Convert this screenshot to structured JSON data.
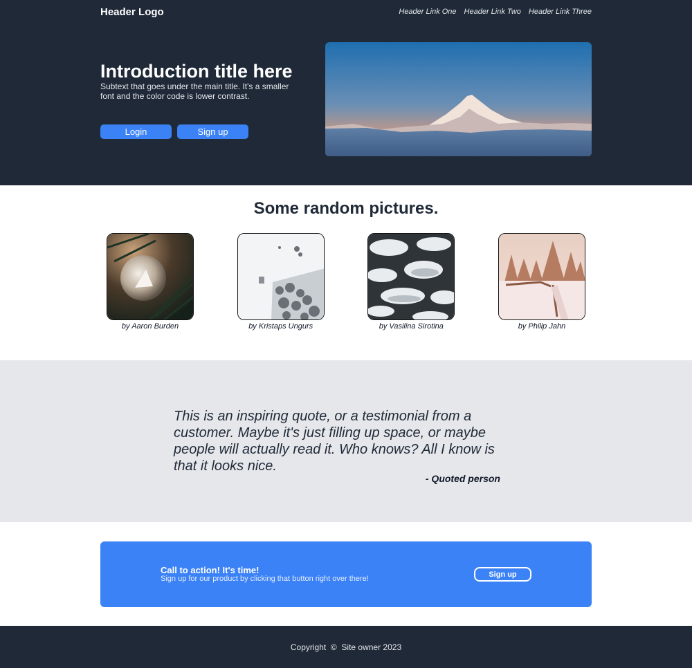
{
  "header": {
    "logo": "Header Logo",
    "links": [
      "Header Link One",
      "Header Link Two",
      "Header Link Three"
    ]
  },
  "hero": {
    "title": "Introduction title here",
    "subtitle": "Subtext that goes under the main title. It's a smaller font and the color code is lower contrast.",
    "login_label": "Login",
    "signup_label": "Sign up",
    "image_icon": "mountain-image"
  },
  "pictures": {
    "title": "Some random pictures.",
    "items": [
      {
        "caption": "by Aaron Burden",
        "icon": "ornament-photo"
      },
      {
        "caption": "by Kristaps Ungurs",
        "icon": "snowy-aerial-photo"
      },
      {
        "caption": "by Vasilina Sirotina",
        "icon": "snowy-pine-photo"
      },
      {
        "caption": "by Philip Jahn",
        "icon": "winter-forest-photo"
      }
    ]
  },
  "quote": {
    "text": "This is an inspiring quote, or a testimonial from a customer. Maybe it's just filling up space, or maybe people will actually read it. Who knows? All I know is that it looks nice.",
    "author": "- Quoted person"
  },
  "cta": {
    "title": "Call to action! It's time!",
    "subtitle": "Sign up for our product by clicking that button right over there!",
    "button_label": "Sign up"
  },
  "footer": {
    "copyright": "Copyright  ©  Site owner 2023"
  },
  "colors": {
    "dark": "#1f2937",
    "accent": "#3b82f6",
    "quote_bg": "#e5e7eb"
  }
}
